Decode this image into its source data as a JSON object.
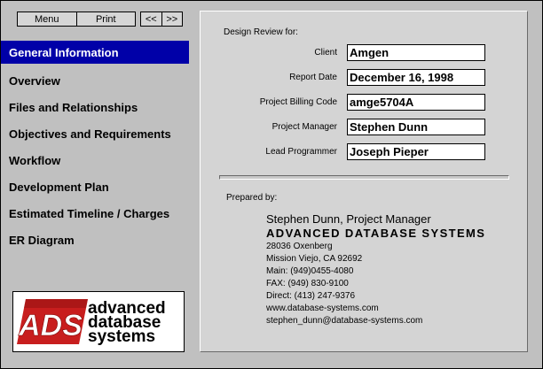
{
  "toolbar": {
    "menu_label": "Menu",
    "print_label": "Print",
    "prev_label": "<<",
    "next_label": ">>"
  },
  "nav": {
    "items": [
      {
        "label": "General Information",
        "active": true
      },
      {
        "label": "Overview"
      },
      {
        "label": "Files and Relationships"
      },
      {
        "label": "Objectives and Requirements"
      },
      {
        "label": "Workflow"
      },
      {
        "label": "Development Plan"
      },
      {
        "label": "Estimated Timeline / Charges"
      },
      {
        "label": "ER Diagram"
      }
    ]
  },
  "logo": {
    "mark_text": "ADS",
    "line1": "advanced",
    "line2": "database",
    "line3": "systems",
    "colors": {
      "red": "#c81e1e",
      "black": "#000000"
    }
  },
  "form": {
    "heading": "Design Review for:",
    "fields": [
      {
        "label": "Client",
        "value": "Amgen"
      },
      {
        "label": "Report Date",
        "value": "December 16, 1998"
      },
      {
        "label": "Project Billing Code",
        "value": "amge5704A"
      },
      {
        "label": "Project Manager",
        "value": "Stephen Dunn"
      },
      {
        "label": "Lead Programmer",
        "value": "Joseph Pieper"
      }
    ]
  },
  "prepared": {
    "label": "Prepared by:",
    "person": "Stephen Dunn, Project Manager",
    "company": "ADVANCED DATABASE SYSTEMS",
    "address1": "28036 Oxenberg",
    "address2": "Mission Viejo, CA 92692",
    "main": "Main: (949)0455-4080",
    "fax": "FAX: (949) 830-9100",
    "direct": "Direct: (413) 247-9376",
    "web": "www.database-systems.com",
    "email": "stephen_dunn@database-systems.com"
  },
  "colors": {
    "nav_active": "#0000a8",
    "panel": "#d4d4d4",
    "window": "#c0c0c0"
  }
}
